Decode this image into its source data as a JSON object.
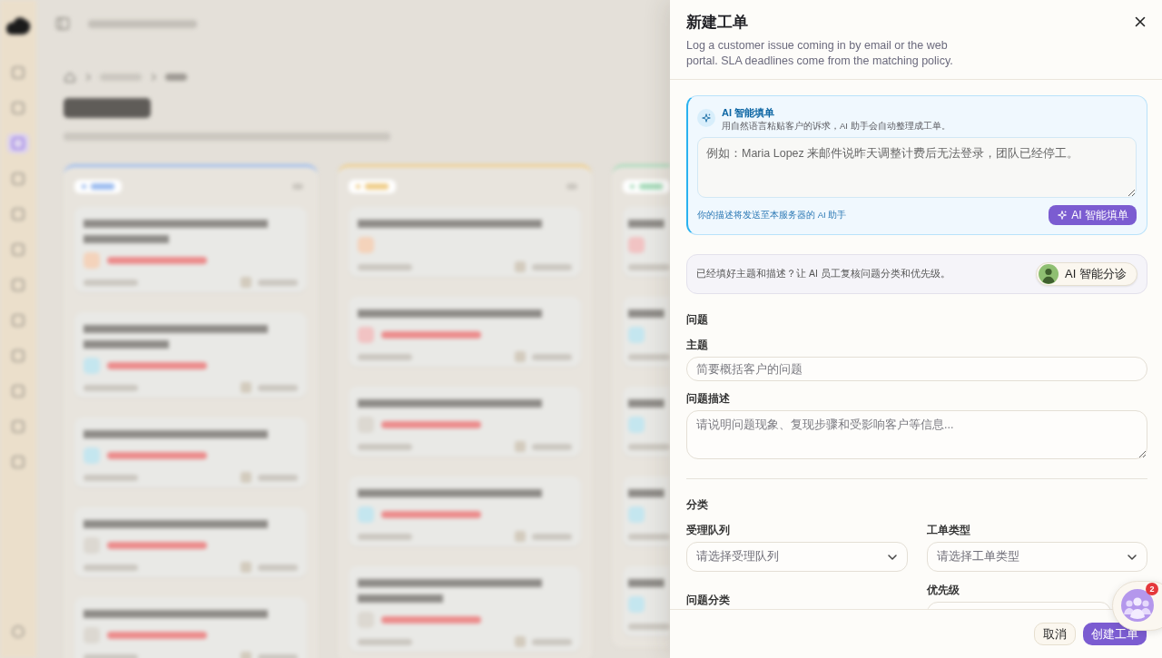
{
  "sidebar": {
    "items": [
      {
        "selected": false
      },
      {
        "selected": false
      },
      {
        "selected": true
      },
      {
        "selected": false
      },
      {
        "selected": false
      },
      {
        "selected": false
      },
      {
        "selected": false
      },
      {
        "selected": false
      },
      {
        "selected": false
      },
      {
        "selected": false
      },
      {
        "selected": false
      },
      {
        "selected": false
      }
    ],
    "footer_items": [
      {
        "selected": false
      }
    ]
  },
  "board": {
    "columns": [
      {
        "color": "#9dbdf0",
        "cards": [
          {
            "kind": "two_line",
            "color": "#f4d3bb",
            "overdue": true
          },
          {
            "kind": "two_line",
            "color": "#c4e6ef",
            "overdue": true
          },
          {
            "kind": "one_line",
            "color": "#c4e6ef",
            "overdue": true
          },
          {
            "kind": "one_line",
            "color": "#dcd8d1",
            "overdue": true
          },
          {
            "kind": "one_line",
            "color": "#dcd8d1",
            "overdue": true
          }
        ]
      },
      {
        "color": "#f0cf8c",
        "cards": [
          {
            "kind": "one_line",
            "color": "#f4d3bb",
            "overdue": false
          },
          {
            "kind": "one_line",
            "color": "#f1c3c3",
            "overdue": true
          },
          {
            "kind": "one_line",
            "color": "#dcd8d1",
            "overdue": true
          },
          {
            "kind": "one_line",
            "color": "#c4e6ef",
            "overdue": true
          },
          {
            "kind": "two_line",
            "color": "#dcd8d1",
            "overdue": true
          }
        ]
      },
      {
        "color": "#a9dcbc",
        "cards": [
          {
            "kind": "one_line",
            "color": "#f1c3c3",
            "overdue": false
          },
          {
            "kind": "one_line",
            "color": "#c4e6ef",
            "overdue": false
          },
          {
            "kind": "one_line",
            "color": "#c4e6ef",
            "overdue": false
          },
          {
            "kind": "one_line",
            "color": "#c4e6ef",
            "overdue": false
          },
          {
            "kind": "one_line",
            "color": "#c4e6ef",
            "overdue": false
          }
        ]
      }
    ]
  },
  "drawer": {
    "title": "新建工单",
    "subtitle": "Log a customer issue coming in by email or the web portal. SLA deadlines come from the matching policy.",
    "ai_fill": {
      "title": "AI 智能填单",
      "description": "用自然语言粘贴客户的诉求，AI 助手会自动整理成工单。",
      "placeholder": "例如：Maria Lopez 来邮件说昨天调整计费后无法登录，团队已经停工。",
      "note": "你的描述将发送至本服务器的 AI 助手",
      "button": "AI 智能填单"
    },
    "triage": {
      "text": "已经填好主题和描述？让 AI 员工复核问题分类和优先级。",
      "button": "AI 智能分诊"
    },
    "sections": [
      {
        "title": "问题",
        "kind": "stack",
        "fields": [
          {
            "kind": "input",
            "label": "主题",
            "placeholder": "简要概括客户的问题"
          },
          {
            "kind": "textarea",
            "label": "问题描述",
            "placeholder": "请说明问题现象、复现步骤和受影响客户等信息..."
          }
        ]
      },
      {
        "title": "分类",
        "kind": "two_columns",
        "fields": [
          {
            "kind": "select",
            "label": "受理队列",
            "placeholder": "请选择受理队列"
          },
          {
            "kind": "select",
            "label": "问题分类"
          },
          {
            "kind": "select",
            "label": "工单类型",
            "placeholder": "请选择工单类型"
          },
          {
            "kind": "select",
            "label": "优先级"
          }
        ]
      }
    ],
    "footer": {
      "buttons": [
        {
          "label": "取消",
          "kind": "secondary"
        },
        {
          "label": "创建工单",
          "kind": "primary"
        }
      ]
    }
  },
  "chat_widget": {
    "badge": "2"
  }
}
